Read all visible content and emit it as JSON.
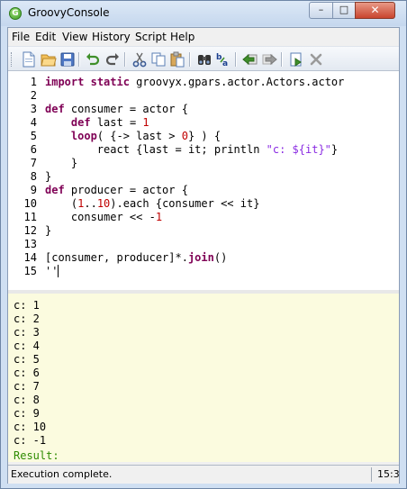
{
  "window": {
    "title": "GroovyConsole",
    "app_icon_letter": "G"
  },
  "controls": {
    "minimize": "–",
    "maximize": "□",
    "close": "✕"
  },
  "menu": [
    "File",
    "Edit",
    "View",
    "History",
    "Script",
    "Help"
  ],
  "toolbar": {
    "buttons": [
      "new-document",
      "open-folder",
      "save",
      "undo",
      "redo",
      "cut",
      "copy",
      "paste",
      "find",
      "replace",
      "history-back",
      "history-forward",
      "run",
      "interrupt"
    ],
    "disabled": [
      "history-forward",
      "interrupt"
    ]
  },
  "editor": {
    "line_numbers": [
      "1",
      "2",
      "3",
      "4",
      "5",
      "6",
      "7",
      "8",
      "9",
      "10",
      "11",
      "12",
      "13",
      "14",
      "15"
    ],
    "lines": [
      "import static groovyx.gpars.actor.Actors.actor",
      "",
      "def consumer = actor {",
      "    def last = 1",
      "    loop( {-> last > 0} ) {",
      "        react {last = it; println \"c: ${it}\"}",
      "    }",
      "}",
      "def producer = actor {",
      "    (1..10).each {consumer << it}",
      "    consumer << -1",
      "}",
      "",
      "[consumer, producer]*.join()",
      "''"
    ]
  },
  "output": {
    "lines": [
      "c: 1",
      "c: 2",
      "c: 3",
      "c: 4",
      "c: 5",
      "c: 6",
      "c: 7",
      "c: 8",
      "c: 9",
      "c: 10",
      "c: -1"
    ],
    "result": "Result:"
  },
  "status": {
    "message": "Execution complete.",
    "caret_position": "15:3"
  },
  "colors": {
    "keyword": "#7f0055",
    "number": "#c00000",
    "string": "#8a2be2",
    "output_bg": "#fbfbdf",
    "result": "#2e8b00"
  }
}
